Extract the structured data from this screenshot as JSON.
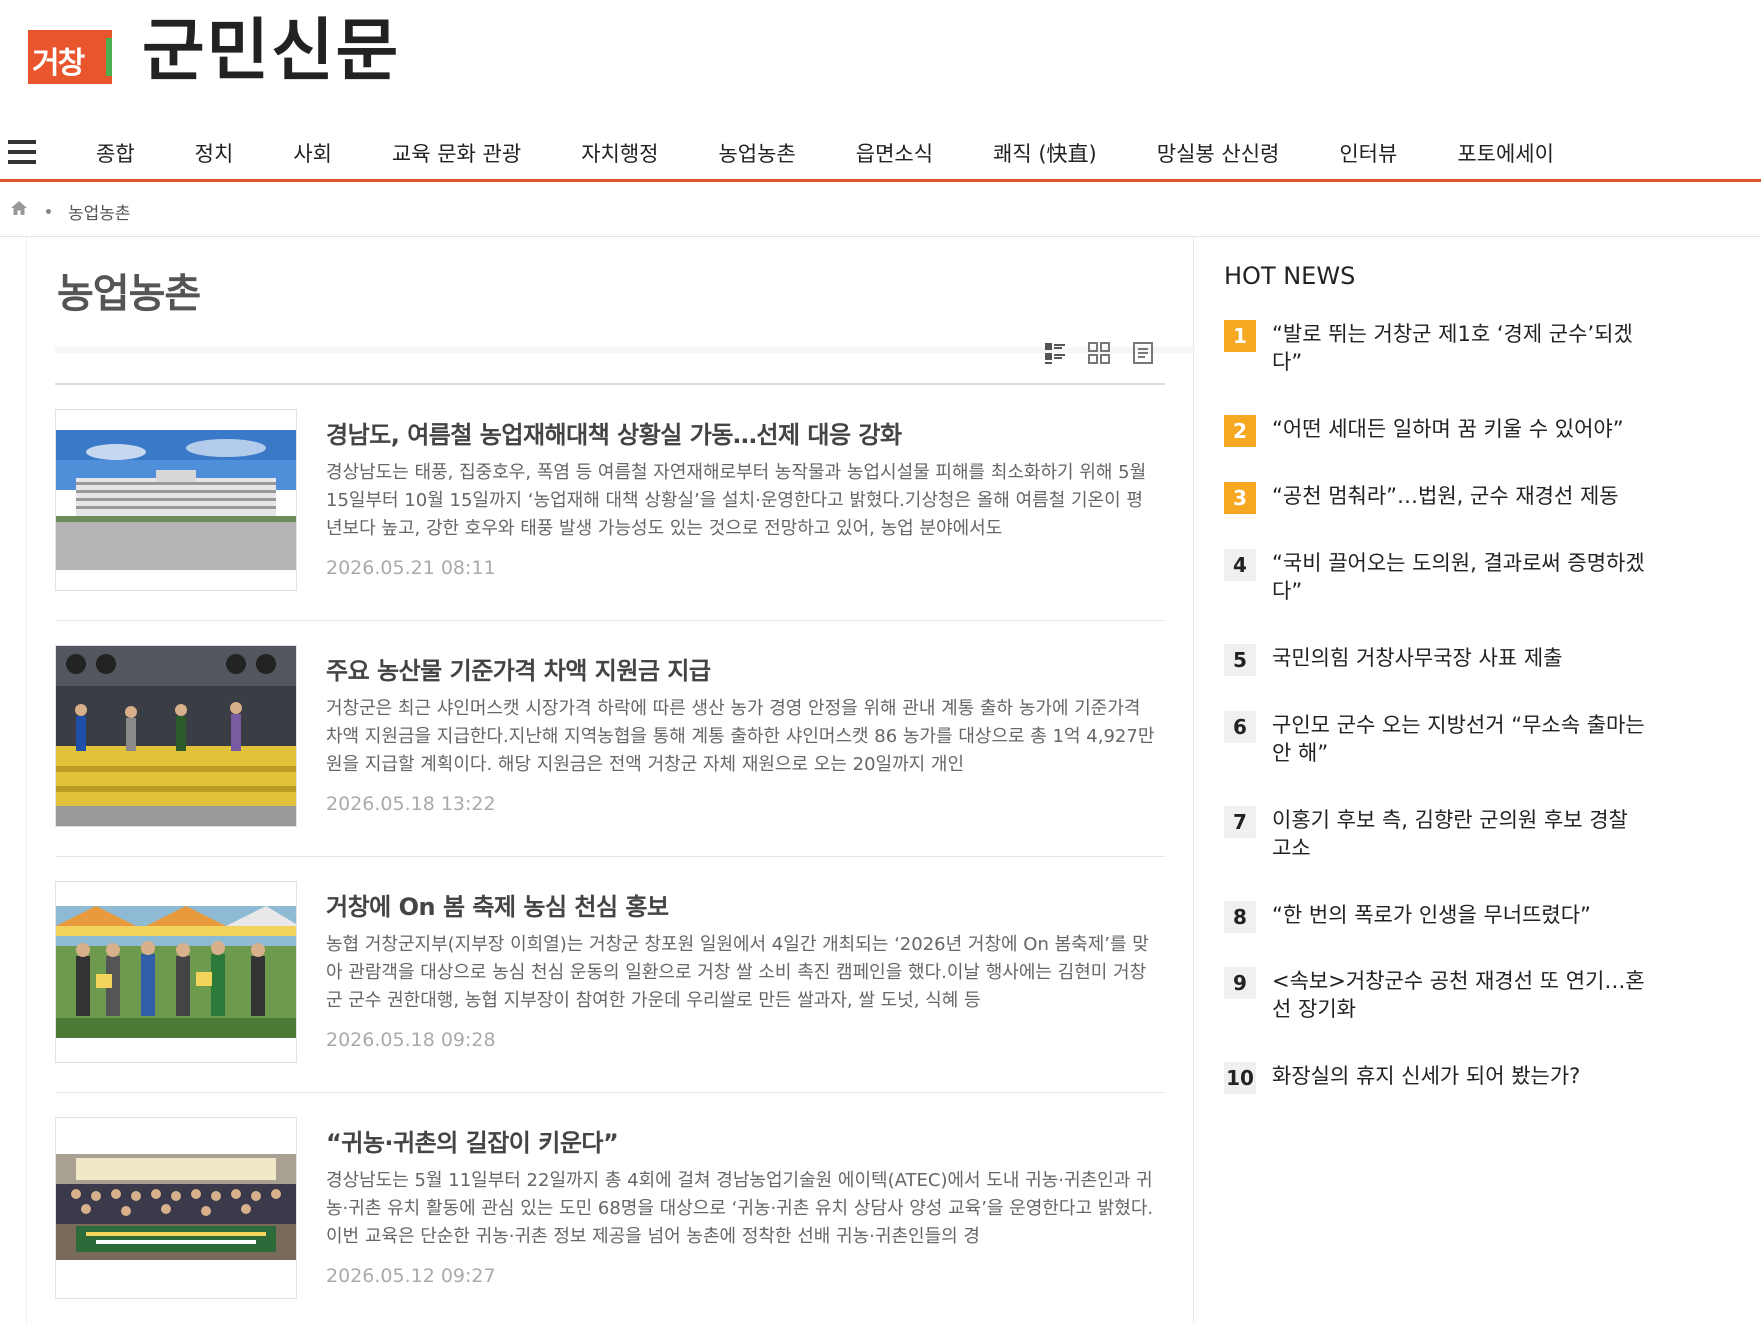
{
  "logo": {
    "badge": "거창",
    "name": "군민신문"
  },
  "nav": {
    "items": [
      "종합",
      "정치",
      "사회",
      "교육 문화 관광",
      "자치행정",
      "농업농촌",
      "읍면소식",
      "쾌직 (快直)",
      "망실봉 산신령",
      "인터뷰",
      "포토에세이"
    ]
  },
  "breadcrumb": {
    "current": "농업농촌"
  },
  "section": {
    "title": "농업농촌"
  },
  "articles": [
    {
      "title": "경남도, 여름철 농업재해대책 상황실 가동…선제 대응 강화",
      "summary": "경상남도는 태풍, 집중호우, 폭염 등 여름철 자연재해로부터 농작물과 농업시설물 피해를 최소화하기 위해 5월 15일부터 10월 15일까지 ‘농업재해 대책 상황실’을 설치·운영한다고 밝혔다.기상청은 올해 여름철 기온이 평년보다 높고, 강한 호우와 태풍 발생 가능성도 있는 것으로 전망하고 있어, 농업 분야에서도",
      "date": "2026.05.21 08:11"
    },
    {
      "title": "주요 농산물 기준가격 차액 지원금 지급",
      "summary": "거창군은 최근 샤인머스캣 시장가격 하락에 따른 생산 농가 경영 안정을 위해 관내 계통 출하 농가에 기준가격 차액 지원금을 지급한다.지난해 지역농협을 통해 계통 출하한 샤인머스캣 86 농가를 대상으로 총 1억 4,927만 원을 지급할 계획이다. 해당 지원금은 전액 거창군 자체 재원으로 오는 20일까지 개인",
      "date": "2026.05.18 13:22"
    },
    {
      "title": "거창에 On 봄 축제 농심 천심 홍보",
      "summary": "농협 거창군지부(지부장 이희열)는 거창군 창포원 일원에서 4일간 개최되는 ‘2026년 거창에 On 봄축제’를 맞아 관람객을 대상으로 농심 천심 운동의 일환으로 거창 쌀 소비 촉진 캠페인을 했다.이날 행사에는 김현미 거창군 군수 권한대행, 농협 지부장이 참여한 가운데 우리쌀로 만든 쌀과자, 쌀 도넛, 식혜 등",
      "date": "2026.05.18 09:28"
    },
    {
      "title": "“귀농·귀촌의 길잡이 키운다”",
      "summary": "경상남도는 5월 11일부터 22일까지 총 4회에 걸쳐 경남농업기술원 에이텍(ATEC)에서 도내 귀농·귀촌인과 귀농·귀촌 유치 활동에 관심 있는 도민 68명을 대상으로 ‘귀농·귀촌 유치 상담사 양성 교육’을 운영한다고 밝혔다.이번 교육은 단순한 귀농·귀촌 정보 제공을 넘어 농촌에 정착한 선배 귀농·귀촌인들의 경",
      "date": "2026.05.12 09:27"
    }
  ],
  "hot_news": {
    "title": "HOT NEWS",
    "items": [
      {
        "rank": "1",
        "text": "“발로 뛰는 거창군 제1호 ‘경제 군수’되겠다”"
      },
      {
        "rank": "2",
        "text": "“어떤 세대든 일하며 꿈 키울 수 있어야”"
      },
      {
        "rank": "3",
        "text": "“공천 멈춰라”…법원, 군수 재경선 제동"
      },
      {
        "rank": "4",
        "text": "“국비 끌어오는 도의원, 결과로써 증명하겠다”"
      },
      {
        "rank": "5",
        "text": "국민의힘 거창사무국장 사표 제출"
      },
      {
        "rank": "6",
        "text": "구인모 군수 오는 지방선거 “무소속 출마는 안 해”"
      },
      {
        "rank": "7",
        "text": "이홍기 후보 측, 김향란 군의원 후보 경찰 고소"
      },
      {
        "rank": "8",
        "text": "“한 번의 폭로가 인생을 무너뜨렸다”"
      },
      {
        "rank": "9",
        "text": "<속보>거창군수 공천 재경선 또 연기…혼선 장기화"
      },
      {
        "rank": "10",
        "text": "화장실의 휴지 신세가 되어 봤는가?"
      }
    ]
  },
  "colors": {
    "accent": "#d9562b",
    "rank_highlight": "#f7a823"
  }
}
